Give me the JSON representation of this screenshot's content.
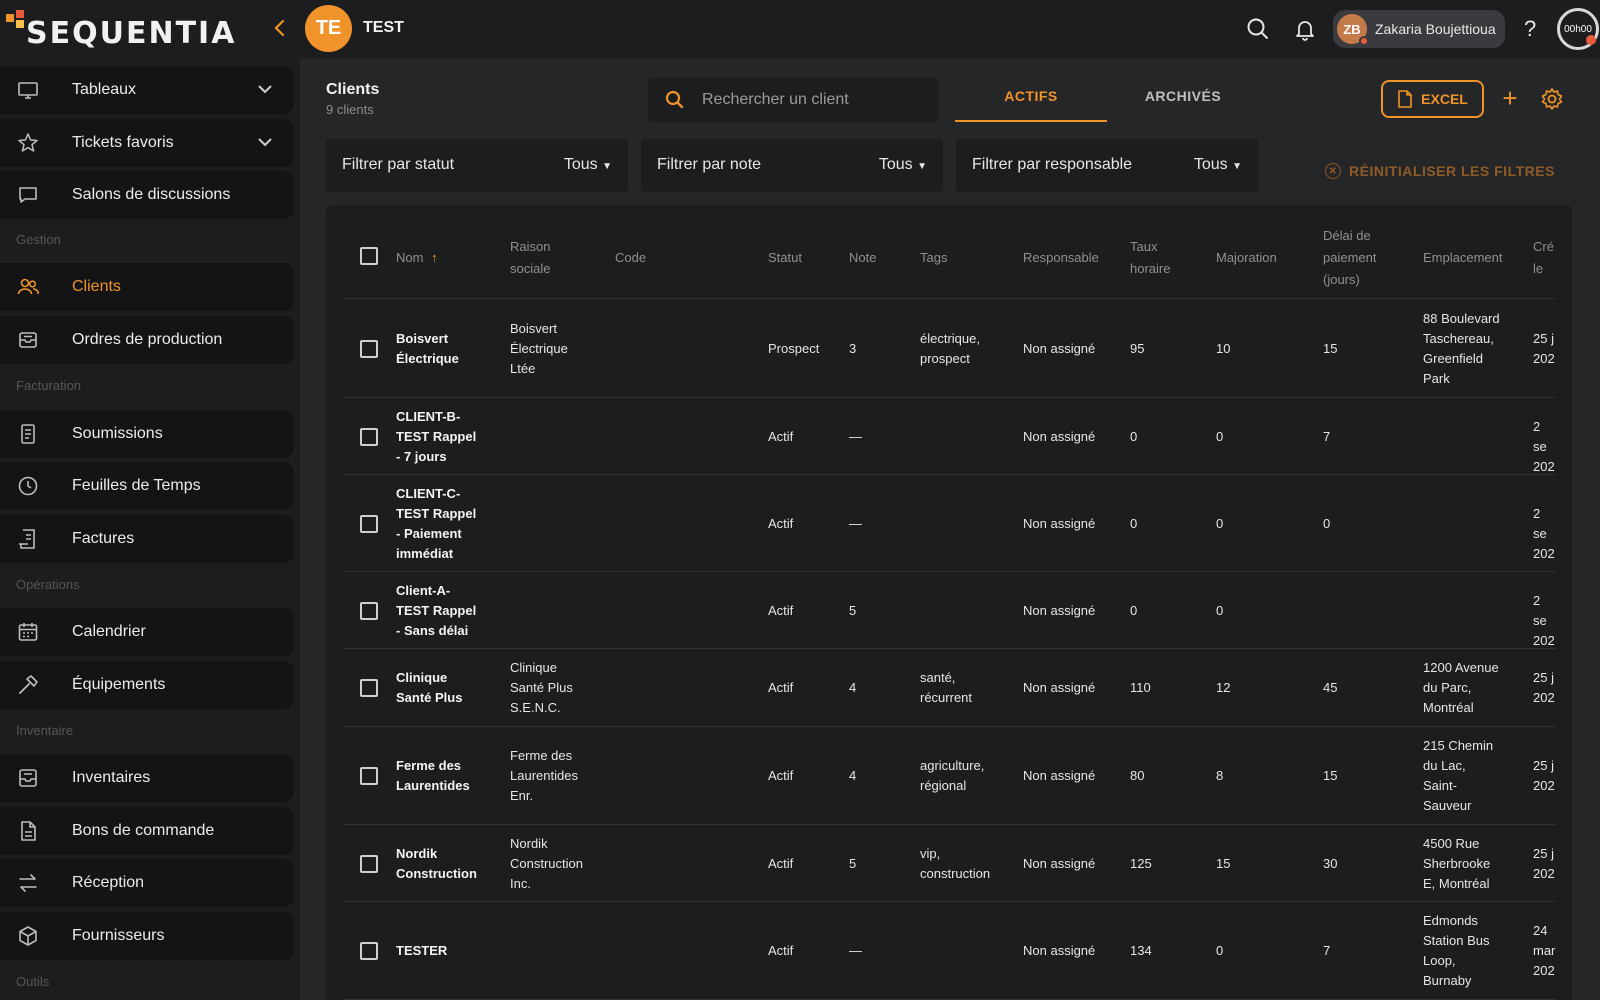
{
  "header": {
    "logo_text": "SEQUENTIA",
    "project_initials": "TE",
    "project_name": "TEST",
    "user_initials": "ZB",
    "user_name": "Zakaria Boujettioua",
    "timer": "00h00",
    "help": "?",
    "accent_color": "#f0932b"
  },
  "sidebar": {
    "items": [
      {
        "label": "Tableaux",
        "icon": "monitor-icon"
      },
      {
        "label": "Tickets favoris",
        "icon": "star-icon"
      },
      {
        "label": "Salons de discussions",
        "icon": "chat-icon"
      },
      {
        "label": "Clients",
        "icon": "users-icon"
      },
      {
        "label": "Ordres de production",
        "icon": "tray-icon"
      },
      {
        "label": "Soumissions",
        "icon": "document-icon"
      },
      {
        "label": "Feuilles de Temps",
        "icon": "clock-icon"
      },
      {
        "label": "Factures",
        "icon": "invoice-icon"
      },
      {
        "label": "Calendrier",
        "icon": "calendar-icon"
      },
      {
        "label": "Équipements",
        "icon": "hammer-icon"
      },
      {
        "label": "Inventaires",
        "icon": "inbox-icon"
      },
      {
        "label": "Bons de commande",
        "icon": "file-icon"
      },
      {
        "label": "Réception",
        "icon": "arrows-icon"
      },
      {
        "label": "Fournisseurs",
        "icon": "box-icon"
      }
    ],
    "sections": [
      "Gestion",
      "Facturation",
      "Opérations",
      "Inventaire",
      "Outils"
    ]
  },
  "main": {
    "title": "Clients",
    "subtitle": "9 clients",
    "search_placeholder": "Rechercher un client",
    "tabs": [
      "ACTIFS",
      "ARCHIVÉS"
    ],
    "excel_label": "EXCEL",
    "plus": "+",
    "filters": [
      {
        "label": "Filtrer par statut",
        "value": "Tous"
      },
      {
        "label": "Filtrer par note",
        "value": "Tous"
      },
      {
        "label": "Filtrer par responsable",
        "value": "Tous"
      }
    ],
    "reset_label": "RÉINITIALISER LES FILTRES"
  },
  "table": {
    "columns": [
      "Nom",
      "Raison sociale",
      "Code",
      "Statut",
      "Note",
      "Tags",
      "Responsable",
      "Taux horaire",
      "Majoration",
      "Délai de paiement (jours)",
      "Emplacement",
      "Cré le"
    ],
    "columns_lines": {
      "raison": [
        "Raison",
        "sociale"
      ],
      "taux": [
        "Taux",
        "horaire"
      ],
      "delai": [
        "Délai de",
        "paiement",
        "(jours)"
      ],
      "cree": [
        "Cré",
        "le"
      ]
    },
    "rows": [
      {
        "nom": [
          "Boisvert",
          "Électrique"
        ],
        "raison": [
          "Boisvert",
          "Électrique",
          "Ltée"
        ],
        "code": "",
        "statut": "Prospect",
        "note": "3",
        "tags": [
          "électrique,",
          "prospect"
        ],
        "responsable": "Non assigné",
        "taux": "95",
        "majoration": "10",
        "delai": "15",
        "emplacement": [
          "88 Boulevard",
          "Taschereau,",
          "Greenfield",
          "Park"
        ],
        "cree": [
          "25 j",
          "202"
        ]
      },
      {
        "nom": [
          "CLIENT-B-",
          "TEST Rappel",
          "- 7 jours"
        ],
        "raison": [],
        "code": "",
        "statut": "Actif",
        "note": "—",
        "tags": [],
        "responsable": "Non assigné",
        "taux": "0",
        "majoration": "0",
        "delai": "7",
        "emplacement": [],
        "cree": [
          "2 se",
          "202"
        ]
      },
      {
        "nom": [
          "CLIENT-C-",
          "TEST Rappel",
          "- Paiement",
          "immédiat"
        ],
        "raison": [],
        "code": "",
        "statut": "Actif",
        "note": "—",
        "tags": [],
        "responsable": "Non assigné",
        "taux": "0",
        "majoration": "0",
        "delai": "0",
        "emplacement": [],
        "cree": [
          "2 se",
          "202"
        ]
      },
      {
        "nom": [
          "Client-A-",
          "TEST Rappel",
          "- Sans délai"
        ],
        "raison": [],
        "code": "",
        "statut": "Actif",
        "note": "5",
        "tags": [],
        "responsable": "Non assigné",
        "taux": "0",
        "majoration": "0",
        "delai": "",
        "emplacement": [],
        "cree": [
          "2 se",
          "202"
        ]
      },
      {
        "nom": [
          "Clinique",
          "Santé Plus"
        ],
        "raison": [
          "Clinique",
          "Santé Plus",
          "S.E.N.C."
        ],
        "code": "",
        "statut": "Actif",
        "note": "4",
        "tags": [
          "santé,",
          "récurrent"
        ],
        "responsable": "Non assigné",
        "taux": "110",
        "majoration": "12",
        "delai": "45",
        "emplacement": [
          "1200 Avenue",
          "du Parc,",
          "Montréal"
        ],
        "cree": [
          "25 j",
          "202"
        ]
      },
      {
        "nom": [
          "Ferme des",
          "Laurentides"
        ],
        "raison": [
          "Ferme des",
          "Laurentides",
          "Enr."
        ],
        "code": "",
        "statut": "Actif",
        "note": "4",
        "tags": [
          "agriculture,",
          "régional"
        ],
        "responsable": "Non assigné",
        "taux": "80",
        "majoration": "8",
        "delai": "15",
        "emplacement": [
          "215 Chemin",
          "du Lac,",
          "Saint-",
          "Sauveur"
        ],
        "cree": [
          "25 j",
          "202"
        ]
      },
      {
        "nom": [
          "Nordik",
          "Construction"
        ],
        "raison": [
          "Nordik",
          "Construction",
          "Inc."
        ],
        "code": "",
        "statut": "Actif",
        "note": "5",
        "tags": [
          "vip,",
          "construction"
        ],
        "responsable": "Non assigné",
        "taux": "125",
        "majoration": "15",
        "delai": "30",
        "emplacement": [
          "4500 Rue",
          "Sherbrooke",
          "E, Montréal"
        ],
        "cree": [
          "25 j",
          "202"
        ]
      },
      {
        "nom": [
          "TESTER"
        ],
        "raison": [],
        "code": "",
        "statut": "Actif",
        "note": "—",
        "tags": [],
        "responsable": "Non assigné",
        "taux": "134",
        "majoration": "0",
        "delai": "7",
        "emplacement": [
          "Edmonds",
          "Station Bus",
          "Loop,",
          "Burnaby"
        ],
        "cree": [
          "24",
          "mar",
          "202"
        ]
      }
    ]
  }
}
